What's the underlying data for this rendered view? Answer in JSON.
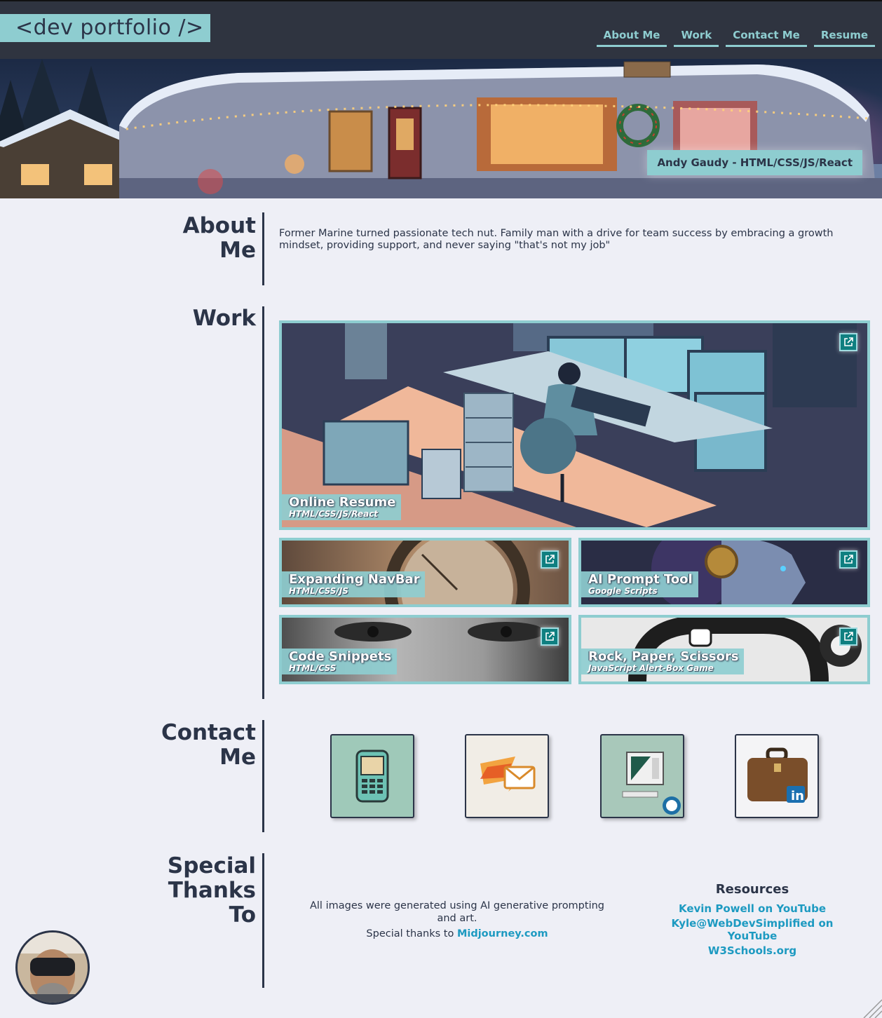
{
  "header": {
    "logo": "<dev portfolio />",
    "nav": [
      "About Me",
      "Work",
      "Contact Me",
      "Resume"
    ]
  },
  "hero": {
    "badge": "Andy Gaudy - HTML/CSS/JS/React"
  },
  "about": {
    "title_line1": "About",
    "title_line2": "Me",
    "text": "Former Marine turned passionate tech nut. Family man with a drive for team success by embracing a growth mindset, providing support, and never saying \"that's not my job\""
  },
  "work": {
    "title": "Work",
    "projects": [
      {
        "title": "Online Resume",
        "subtitle": "HTML/CSS/JS/React",
        "icon": "external-link-icon"
      },
      {
        "title": "Expanding NavBar",
        "subtitle": "HTML/CSS/JS",
        "icon": "external-link-icon"
      },
      {
        "title": "AI Prompt Tool",
        "subtitle": "Google Scripts",
        "icon": "external-link-icon"
      },
      {
        "title": "Code Snippets",
        "subtitle": "HTML/CSS",
        "icon": "external-link-icon"
      },
      {
        "title": "Rock, Paper, Scissors",
        "subtitle": "JavaScript Alert-Box Game",
        "icon": "external-link-icon"
      }
    ]
  },
  "contact": {
    "title_line1": "Contact",
    "title_line2": "Me",
    "buttons": [
      {
        "icon": "phone-icon"
      },
      {
        "icon": "email-icon"
      },
      {
        "icon": "github-computer-icon"
      },
      {
        "icon": "linkedin-briefcase-icon"
      }
    ]
  },
  "thanks": {
    "title_line1": "Special",
    "title_line2": "Thanks",
    "title_line3": "To",
    "text": "All images were generated using AI generative prompting and art.",
    "special_prefix": "Special thanks to ",
    "special_link": "Midjourney.com",
    "resources_title": "Resources",
    "resources": [
      "Kevin Powell on YouTube",
      "Kyle@WebDevSimplified on YouTube",
      "W3Schools.org"
    ]
  },
  "colors": {
    "accent": "#8ecdd0",
    "dark": "#2b3448",
    "header_bg": "#2f3440",
    "page_bg": "#eeeff6",
    "link": "#1d9ac1",
    "icon_bg": "#0f7f80"
  }
}
